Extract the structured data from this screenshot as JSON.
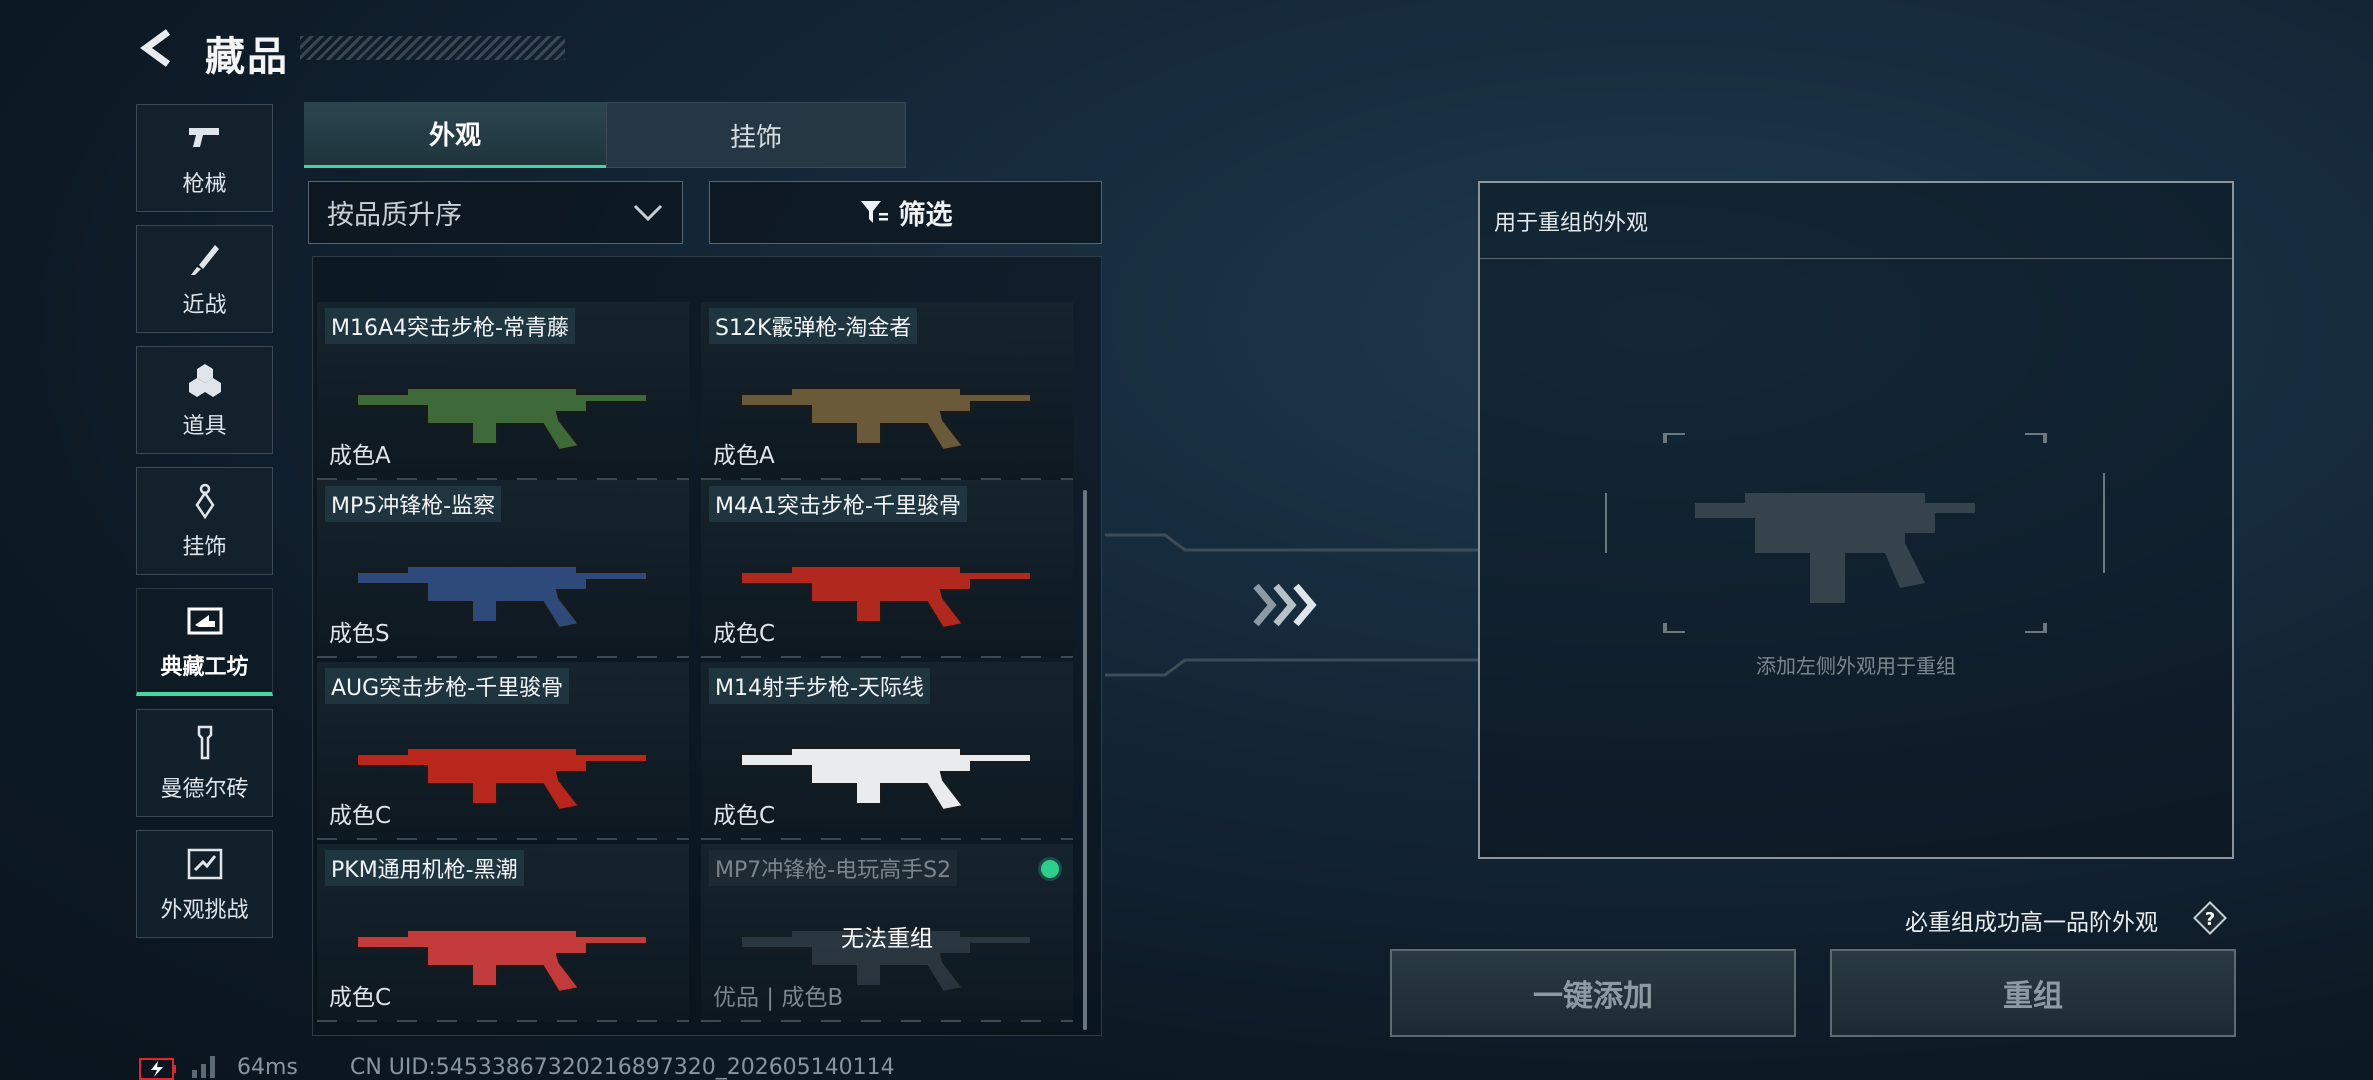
{
  "header": {
    "title": "藏品"
  },
  "sidebar": {
    "items": [
      {
        "label": "枪械",
        "icon": "pistol-icon"
      },
      {
        "label": "近战",
        "icon": "knife-icon"
      },
      {
        "label": "道具",
        "icon": "grenades-icon"
      },
      {
        "label": "挂饰",
        "icon": "charm-icon"
      },
      {
        "label": "典藏工坊",
        "icon": "workshop-icon",
        "active": true
      },
      {
        "label": "曼德尔砖",
        "icon": "brick-icon"
      },
      {
        "label": "外观挑战",
        "icon": "challenge-icon"
      }
    ]
  },
  "tabs": [
    {
      "label": "外观",
      "active": true
    },
    {
      "label": "挂饰",
      "active": false
    }
  ],
  "sort": {
    "value": "按品质升序"
  },
  "filter": {
    "label": "筛选"
  },
  "items": [
    {
      "name": "M16A4突击步枪-常青藤",
      "grade": "成色A",
      "color": "#3e6a3a"
    },
    {
      "name": "S12K霰弹枪-淘金者",
      "grade": "成色A",
      "color": "#6a5a3a"
    },
    {
      "name": "MP5冲锋枪-监察",
      "grade": "成色S",
      "color": "#2e4a7a"
    },
    {
      "name": "M4A1突击步枪-千里骏骨",
      "grade": "成色C",
      "color": "#b0281e"
    },
    {
      "name": "AUG突击步枪-千里骏骨",
      "grade": "成色C",
      "color": "#b8261c"
    },
    {
      "name": "M14射手步枪-天际线",
      "grade": "成色C",
      "color": "#e8ecef"
    },
    {
      "name": "PKM通用机枪-黑潮",
      "grade": "成色C",
      "color": "#c23a3a"
    },
    {
      "name": "MP7冲锋枪-电玩高手S2",
      "grade": "优品 | 成色B",
      "color": "#5a6570",
      "disabled": true,
      "overlay": "无法重组"
    }
  ],
  "recombine": {
    "header": "用于重组的外观",
    "hint": "添加左侧外观用于重组"
  },
  "rule": {
    "text": "必重组成功高一品阶外观"
  },
  "buttons": {
    "add": "一键添加",
    "recombine": "重组"
  },
  "status": {
    "ping": "64ms",
    "uid": "CN UID:54533867320216897320_202605140114"
  },
  "colors": {
    "accent": "#46d4a0",
    "status_dot": "#2ccf8a",
    "battery_alert": "#e0262a"
  }
}
